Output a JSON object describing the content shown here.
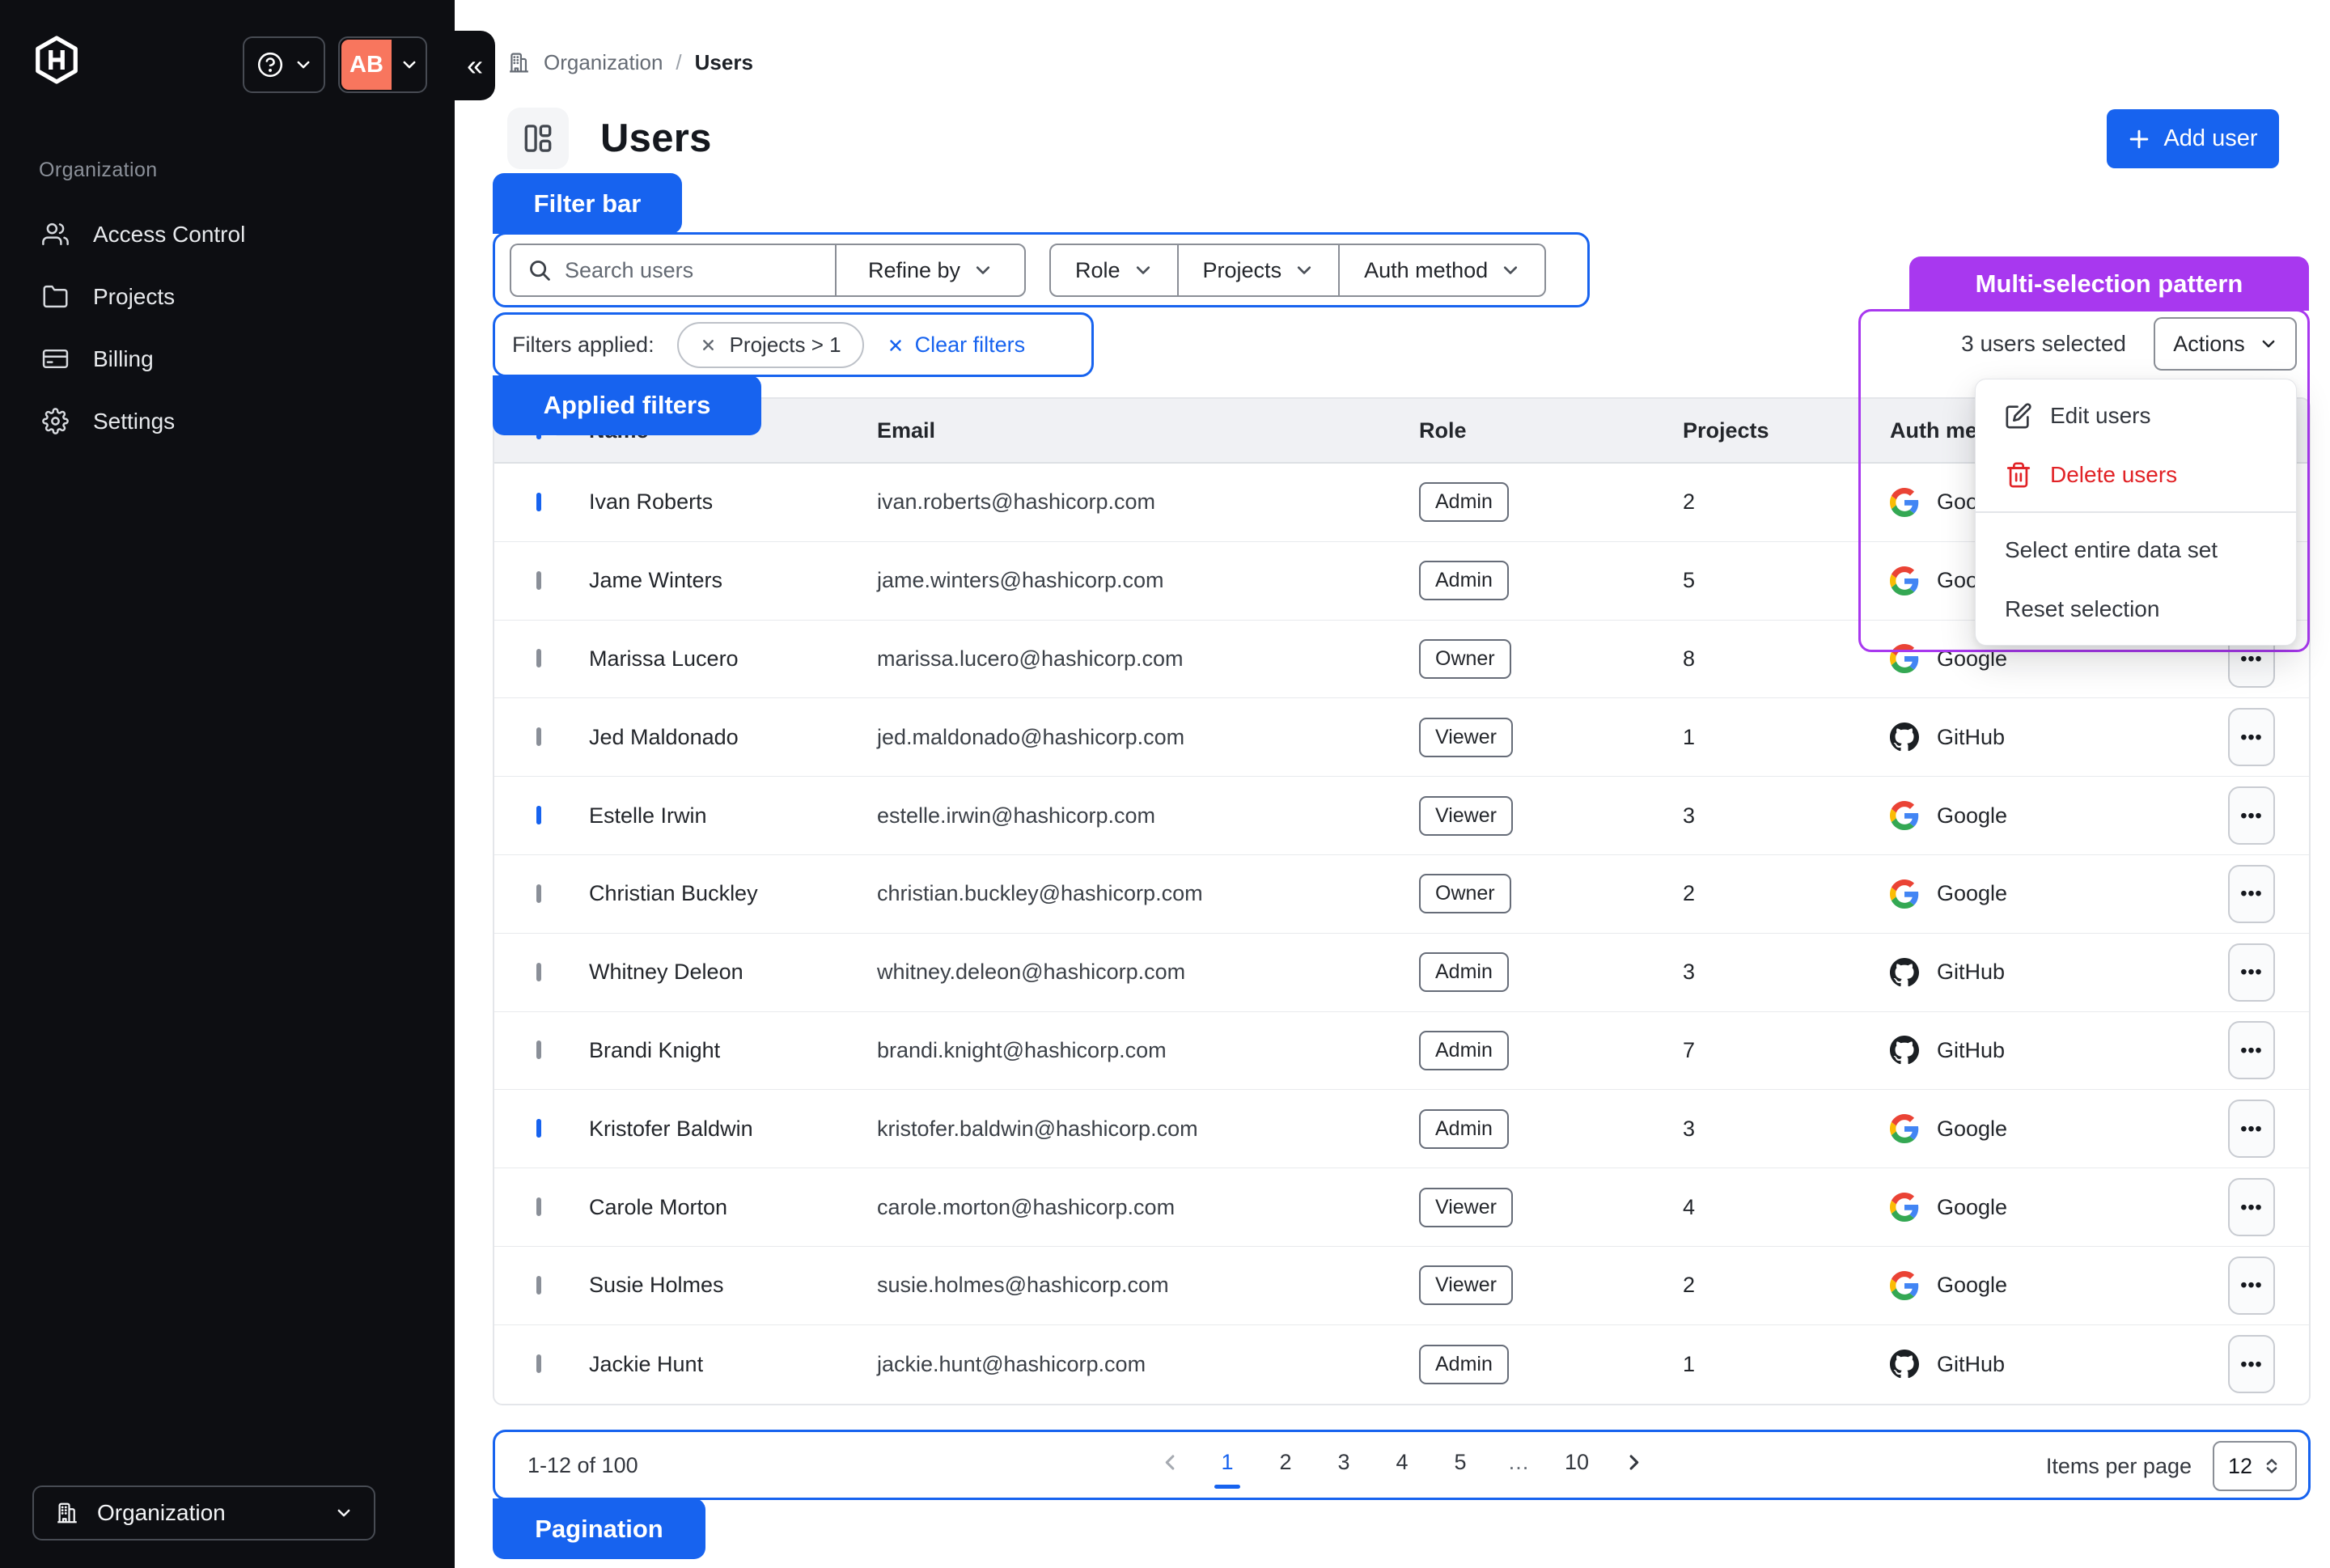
{
  "colors": {
    "accent": "#1763EF",
    "purple": "#A838EF",
    "danger": "#E12226",
    "avatar": "#F8765E",
    "sidebar_bg": "#0D0E12",
    "google": {
      "blue": "#4285F4",
      "green": "#34A853",
      "yellow": "#FBBC05",
      "red": "#EA4335"
    },
    "github": "#1B1F23"
  },
  "sidebar": {
    "section_label": "Organization",
    "avatar_initials": "AB",
    "collapse_glyph": "«",
    "nav": [
      {
        "label": "Access Control",
        "icon": "users-icon"
      },
      {
        "label": "Projects",
        "icon": "folder-icon"
      },
      {
        "label": "Billing",
        "icon": "credit-card-icon"
      },
      {
        "label": "Settings",
        "icon": "gear-icon"
      }
    ],
    "org_switcher_label": "Organization"
  },
  "breadcrumb": {
    "root": "Organization",
    "separator": "/",
    "current": "Users"
  },
  "page": {
    "title": "Users",
    "add_user_label": "Add user"
  },
  "annotations": {
    "filter_bar": "Filter bar",
    "applied_filters": "Applied filters",
    "multi_selection": "Multi-selection pattern",
    "pagination": "Pagination"
  },
  "filter_bar": {
    "search_placeholder": "Search users",
    "refine_by_label": "Refine by",
    "dropdowns": [
      {
        "label": "Role"
      },
      {
        "label": "Projects"
      },
      {
        "label": "Auth method"
      }
    ]
  },
  "applied_filters": {
    "label": "Filters applied:",
    "chips": [
      {
        "label": "Projects > 1"
      }
    ],
    "clear_label": "Clear filters"
  },
  "selection": {
    "count_label": "3 users selected",
    "actions_label": "Actions",
    "menu": [
      {
        "label": "Edit users",
        "icon": "edit-icon",
        "danger": false
      },
      {
        "label": "Delete users",
        "icon": "trash-icon",
        "danger": true
      },
      {
        "divider": true
      },
      {
        "label": "Select entire data set"
      },
      {
        "label": "Reset selection"
      }
    ]
  },
  "table": {
    "header_checkbox_state": "indeterminate",
    "columns": [
      "Name",
      "Email",
      "Role",
      "Projects",
      "Auth method"
    ],
    "rows": [
      {
        "name": "Ivan Roberts",
        "email": "ivan.roberts@hashicorp.com",
        "role": "Admin",
        "projects": "2",
        "auth": "Google",
        "auth_icon": "google-icon",
        "checked": true
      },
      {
        "name": "Jame Winters",
        "email": "jame.winters@hashicorp.com",
        "role": "Admin",
        "projects": "5",
        "auth": "Google",
        "auth_icon": "google-icon",
        "checked": false
      },
      {
        "name": "Marissa Lucero",
        "email": "marissa.lucero@hashicorp.com",
        "role": "Owner",
        "projects": "8",
        "auth": "Google",
        "auth_icon": "google-icon",
        "checked": false
      },
      {
        "name": "Jed Maldonado",
        "email": "jed.maldonado@hashicorp.com",
        "role": "Viewer",
        "projects": "1",
        "auth": "GitHub",
        "auth_icon": "github-icon",
        "checked": false
      },
      {
        "name": "Estelle Irwin",
        "email": "estelle.irwin@hashicorp.com",
        "role": "Viewer",
        "projects": "3",
        "auth": "Google",
        "auth_icon": "google-icon",
        "checked": true
      },
      {
        "name": "Christian Buckley",
        "email": "christian.buckley@hashicorp.com",
        "role": "Owner",
        "projects": "2",
        "auth": "Google",
        "auth_icon": "google-icon",
        "checked": false
      },
      {
        "name": "Whitney Deleon",
        "email": "whitney.deleon@hashicorp.com",
        "role": "Admin",
        "projects": "3",
        "auth": "GitHub",
        "auth_icon": "github-icon",
        "checked": false
      },
      {
        "name": "Brandi Knight",
        "email": "brandi.knight@hashicorp.com",
        "role": "Admin",
        "projects": "7",
        "auth": "GitHub",
        "auth_icon": "github-icon",
        "checked": false
      },
      {
        "name": "Kristofer Baldwin",
        "email": "kristofer.baldwin@hashicorp.com",
        "role": "Admin",
        "projects": "3",
        "auth": "Google",
        "auth_icon": "google-icon",
        "checked": true
      },
      {
        "name": "Carole Morton",
        "email": "carole.morton@hashicorp.com",
        "role": "Viewer",
        "projects": "4",
        "auth": "Google",
        "auth_icon": "google-icon",
        "checked": false
      },
      {
        "name": "Susie Holmes",
        "email": "susie.holmes@hashicorp.com",
        "role": "Viewer",
        "projects": "2",
        "auth": "Google",
        "auth_icon": "google-icon",
        "checked": false
      },
      {
        "name": "Jackie Hunt",
        "email": "jackie.hunt@hashicorp.com",
        "role": "Admin",
        "projects": "1",
        "auth": "GitHub",
        "auth_icon": "github-icon",
        "checked": false
      }
    ]
  },
  "pagination": {
    "range_label": "1-12 of 100",
    "pages": [
      "1",
      "2",
      "3",
      "4",
      "5",
      "…",
      "10"
    ],
    "current_page": "1",
    "items_per_page_label": "Items per page",
    "items_per_page_value": "12"
  }
}
